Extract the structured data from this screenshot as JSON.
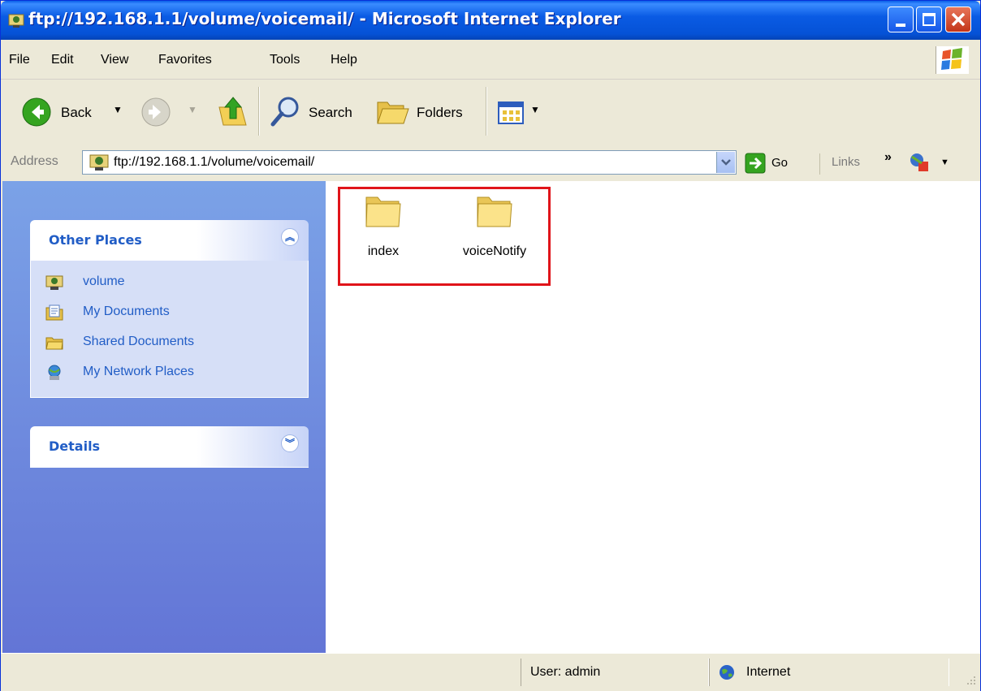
{
  "window": {
    "title": "ftp://192.168.1.1/volume/voicemail/ - Microsoft Internet Explorer"
  },
  "menu": [
    "File",
    "Edit",
    "View",
    "Favorites",
    "Tools",
    "Help"
  ],
  "toolbar": {
    "back": "Back",
    "search": "Search",
    "folders": "Folders"
  },
  "address": {
    "label": "Address",
    "value": "ftp://192.168.1.1/volume/voicemail/",
    "go": "Go",
    "links": "Links"
  },
  "sidebar": {
    "other_places": {
      "title": "Other Places",
      "items": [
        {
          "label": "volume",
          "icon": "ftp-folder-icon"
        },
        {
          "label": "My Documents",
          "icon": "my-documents-icon"
        },
        {
          "label": "Shared Documents",
          "icon": "folder-icon"
        },
        {
          "label": "My Network Places",
          "icon": "network-places-icon"
        }
      ]
    },
    "details": {
      "title": "Details"
    }
  },
  "folders": [
    {
      "label": "index"
    },
    {
      "label": "voiceNotify"
    }
  ],
  "status": {
    "user": "User: admin",
    "zone": "Internet"
  },
  "colors": {
    "titlebar": "#0a5be4",
    "link": "#215dc6",
    "highlight": "#e0141a",
    "pane": "#6f8cdc"
  }
}
